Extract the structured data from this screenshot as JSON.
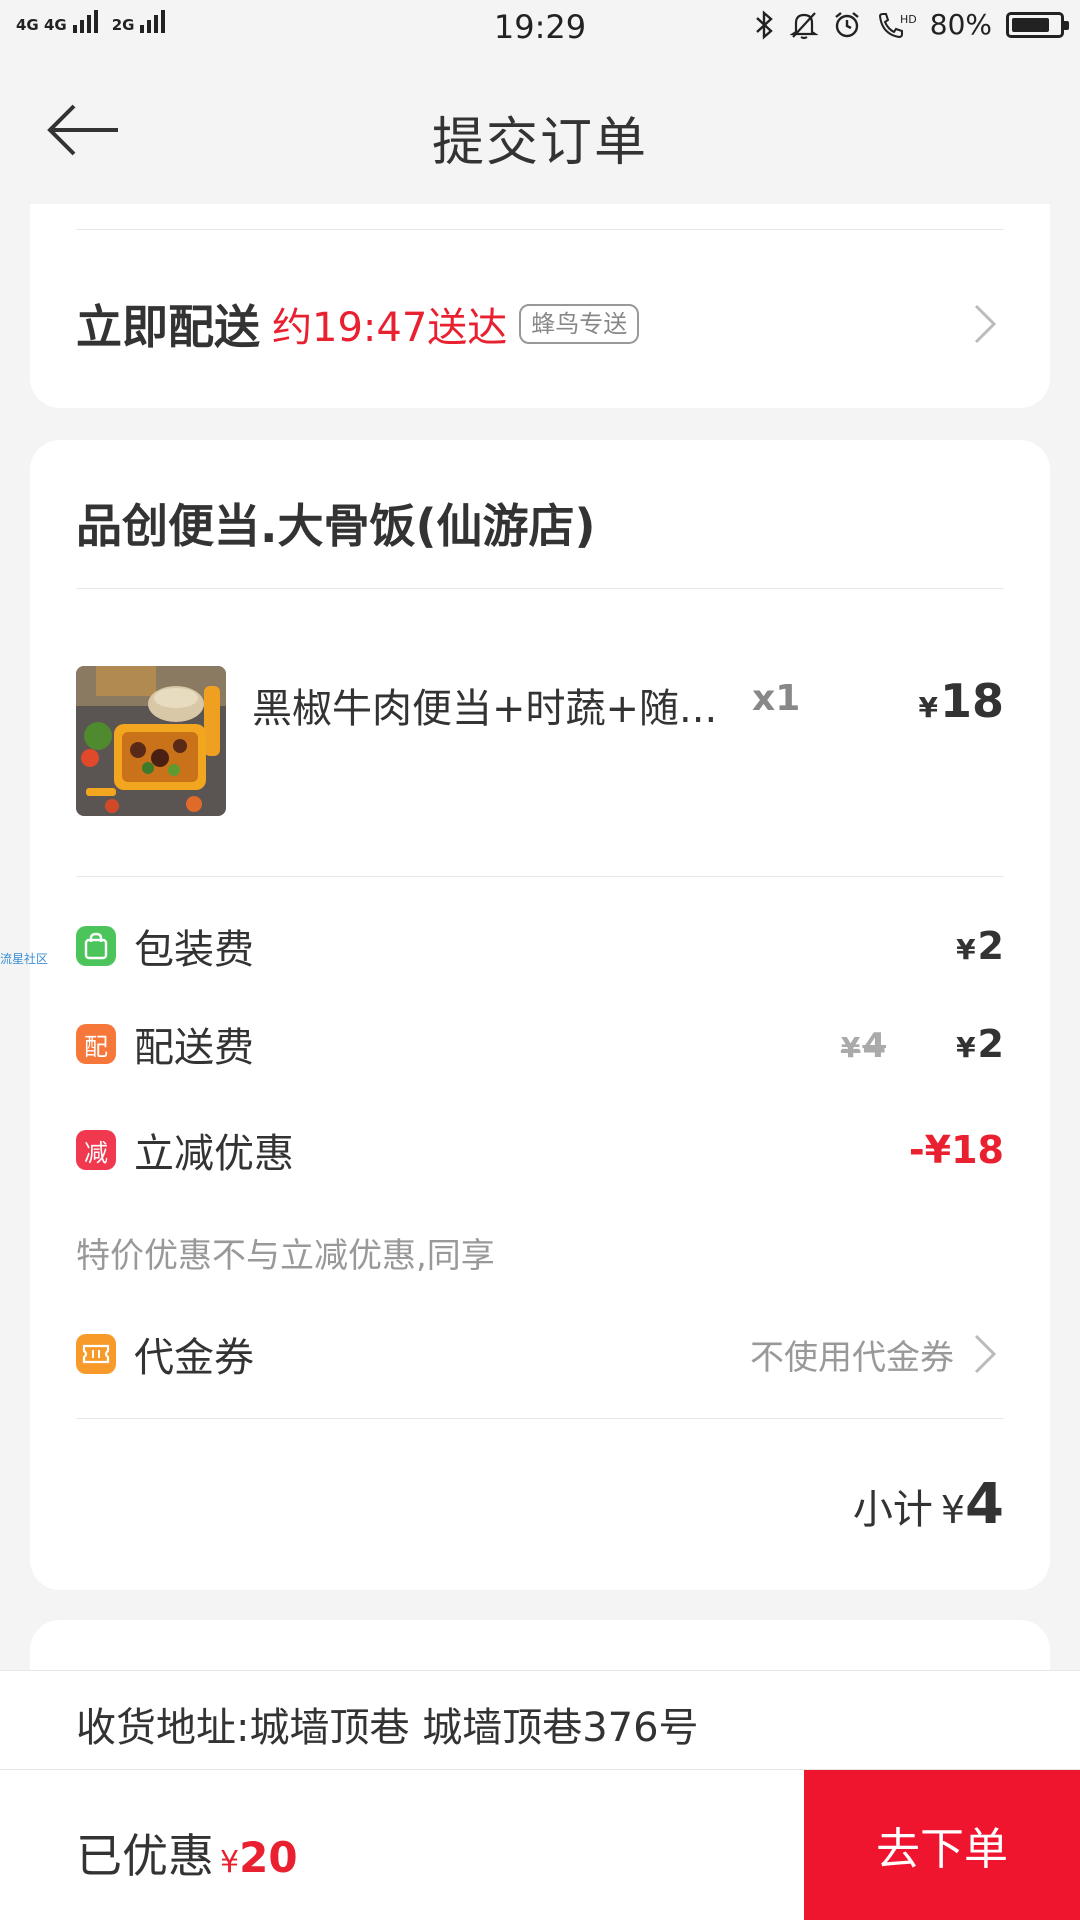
{
  "status_bar": {
    "sim1_label": "4G 4G",
    "sim2_label": "2G",
    "time": "19:29",
    "battery_text": "80%",
    "battery_level": 0.8,
    "icons": [
      "bluetooth-icon",
      "bell-muted-icon",
      "alarm-icon",
      "hd-call-icon",
      "battery-icon"
    ]
  },
  "header": {
    "title": "提交订单"
  },
  "delivery": {
    "label": "立即配送",
    "eta": "约19:47送达",
    "carrier": "蜂鸟专送"
  },
  "shop": {
    "name": "品创便当.大骨饭(仙游店)"
  },
  "item": {
    "name": "黑椒牛肉便当+时蔬+随...",
    "qty": "x1",
    "currency": "¥",
    "price": "18"
  },
  "fees": {
    "packaging": {
      "icon_text": "",
      "label": "包装费",
      "currency": "¥",
      "value": "2"
    },
    "delivery": {
      "icon_text": "配",
      "label": "配送费",
      "old_currency": "¥",
      "old_value": "4",
      "currency": "¥",
      "value": "2"
    },
    "discount": {
      "icon_text": "减",
      "label": "立减优惠",
      "value": "-¥18"
    }
  },
  "note": "特价优惠不与立减优惠,同享",
  "voucher": {
    "label": "代金券",
    "value": "不使用代金券"
  },
  "subtotal": {
    "label": "小计",
    "currency": "¥",
    "value": "4"
  },
  "address": {
    "text": "收货地址:城墙顶巷 城墙顶巷376号"
  },
  "bottom": {
    "discount_label": "已优惠",
    "currency": "¥",
    "discount_value": "20",
    "order_button": "去下单"
  },
  "side_watermark": "流星社区",
  "colors": {
    "accent_red": "#f0152f",
    "green_icon": "#4cc45c",
    "orange_icon": "#f6773a",
    "red_icon": "#f0384f",
    "voucher_icon": "#f89a2a"
  }
}
